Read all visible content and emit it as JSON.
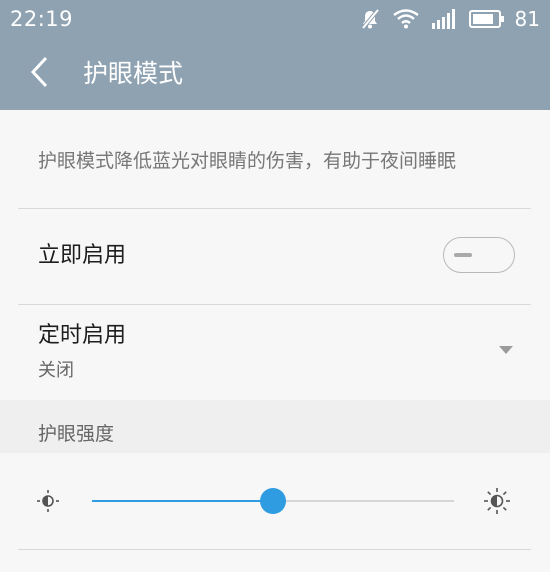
{
  "status_bar": {
    "time": "22:19",
    "icons": [
      "notifications-muted-icon",
      "wifi-icon",
      "signal-icon",
      "battery-icon"
    ],
    "battery_level": "81"
  },
  "app_bar": {
    "back_icon": "back-arrow-icon",
    "title": "护眼模式"
  },
  "content": {
    "description": "护眼模式降低蓝光对眼睛的伤害，有助于夜间睡眠",
    "enable_now": {
      "label": "立即启用",
      "toggle_on": false
    },
    "scheduled": {
      "label": "定时启用",
      "value": "关闭"
    },
    "intensity_section": {
      "title": "护眼强度",
      "slider_value_percent": 50,
      "min_icon": "low-brightness-icon",
      "max_icon": "high-brightness-icon"
    }
  },
  "colors": {
    "header_background": "#8fa2b1",
    "accent": "#2f9be1",
    "page_background": "#f7f7f7"
  }
}
